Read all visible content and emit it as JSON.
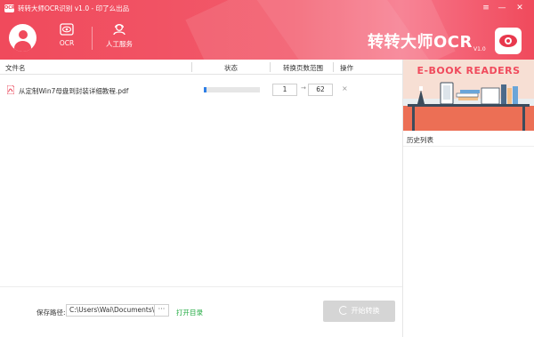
{
  "app": {
    "title": "转转大师OCR识别 v1.0 - 印了么出品",
    "logo_text": "OCR",
    "brand": "转转大师OCR",
    "brand_version": "V1.0",
    "accent_color": "#f04a5c"
  },
  "window_controls": [
    {
      "name": "menu-icon",
      "glyph": "≡"
    },
    {
      "name": "minimize-icon",
      "glyph": "—"
    },
    {
      "name": "close-icon",
      "glyph": "✕"
    }
  ],
  "nav": {
    "ocr_label": "OCR",
    "service_label": "人工服务"
  },
  "table": {
    "headers": {
      "filename": "文件名",
      "status": "状态",
      "page_range": "转换页数范围",
      "action": "操作"
    },
    "rows": [
      {
        "filename": "从定制Win7母盘到封装详细教程.pdf",
        "progress": 0.05,
        "page_from": "1",
        "page_to": "62",
        "arrow": "→",
        "delete": "×"
      }
    ]
  },
  "banner": {
    "title": "E-BOOK READERS"
  },
  "history": {
    "title": "历史列表"
  },
  "footer": {
    "save_label": "保存路径:",
    "save_path": "C:\\Users\\Wai\\Documents\\ZZ",
    "more_label": "···",
    "open_dir_label": "打开目录",
    "convert_label": "开始转换"
  }
}
